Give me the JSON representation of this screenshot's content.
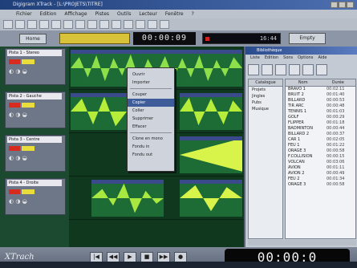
{
  "app": {
    "title": "Digigram XTrack - [L:\\PROJETS\\TITRE]",
    "logo": "XTrach"
  },
  "menu": [
    "Fichier",
    "Edition",
    "Affichage",
    "Pistes",
    "Outils",
    "Lecteur",
    "Fenêtre",
    "?"
  ],
  "transport": {
    "home_label": "Home",
    "empty_label": "Empty",
    "time_small": "00:00:09",
    "time_big": "00:00:0",
    "rec_bits": "16:44"
  },
  "tracks": [
    "Pista 1 - Stereo",
    "Pista 2 - Gauche",
    "Pista 3 - Centre",
    "Pista 4 - Droite"
  ],
  "context_menu": [
    "Ouvrir",
    "Importer",
    "Couper",
    "Copier",
    "Coller",
    "Supprimer",
    "Effacer",
    "Clone en mono",
    "Fondu in",
    "Fondu out"
  ],
  "context_selected": "Copier",
  "library": {
    "title": "Bibliothèque",
    "menu": [
      "Liste",
      "Edition",
      "Sons",
      "Options",
      "Aide"
    ],
    "tree_header": "Catalogue",
    "tree": [
      "Projets",
      "Jingles",
      "Pubs",
      "Musique"
    ],
    "columns": [
      "Nom",
      "Durée"
    ],
    "rows": [
      {
        "name": "BRAVO 1",
        "dur": "00:02:11"
      },
      {
        "name": "BRUIT 2",
        "dur": "00:01:40"
      },
      {
        "name": "BILLARD",
        "dur": "00:00:53"
      },
      {
        "name": "TIR ARC",
        "dur": "00:00:48"
      },
      {
        "name": "TENNIS 1",
        "dur": "00:01:03"
      },
      {
        "name": "GOLF",
        "dur": "00:00:29"
      },
      {
        "name": "FLIPPER",
        "dur": "00:01:18"
      },
      {
        "name": "BADMINTON",
        "dur": "00:00:44"
      },
      {
        "name": "BILLARD 2",
        "dur": "00:00:37"
      },
      {
        "name": "CAR 1",
        "dur": "00:02:05"
      },
      {
        "name": "FEU 1",
        "dur": "00:01:22"
      },
      {
        "name": "ORAGE 3",
        "dur": "00:00:58"
      },
      {
        "name": "F.COLLISION",
        "dur": "00:00:15"
      },
      {
        "name": "VOLCAN",
        "dur": "00:03:06"
      },
      {
        "name": "AVION",
        "dur": "00:01:11"
      },
      {
        "name": "AVION 2",
        "dur": "00:00:49"
      },
      {
        "name": "FEU 2",
        "dur": "00:01:34"
      },
      {
        "name": "ORAGE 3",
        "dur": "00:00:58"
      }
    ]
  },
  "transport_buttons": [
    "|◀",
    "◀◀",
    "▶",
    "■",
    "▶▶",
    "●"
  ]
}
